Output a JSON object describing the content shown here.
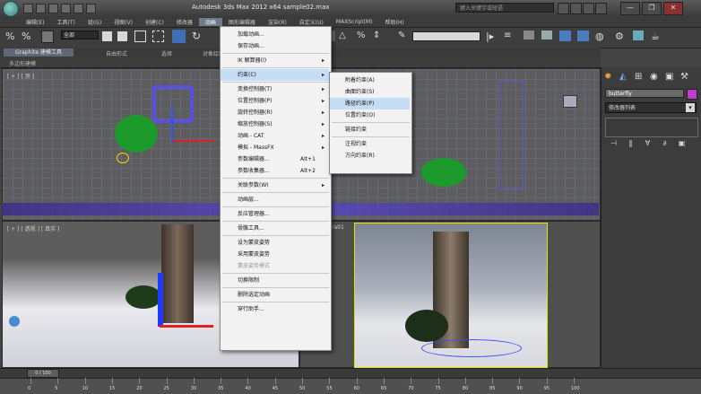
{
  "window": {
    "title": "Autodesk 3ds Max  2012 x64     sample02.max",
    "search_placeholder": "键入关键字或短语",
    "controls": [
      "—",
      "❐",
      "✕"
    ]
  },
  "menubar": {
    "items": [
      "编辑(E)",
      "工具(T)",
      "组(G)",
      "视图(V)",
      "创建(C)",
      "修改器",
      "动画",
      "图形编辑器",
      "渲染(R)",
      "自定义(U)",
      "MAXScript(M)",
      "帮助(H)"
    ]
  },
  "toolbar": {
    "selection_filter": "全部"
  },
  "ribbon": {
    "tabs": [
      "Graphite 建模工具",
      "自由形式",
      "选择",
      "对象绘制"
    ],
    "subbar_label": "多边形建模"
  },
  "viewports": {
    "top_left_label": "[ + ] [ 顶 ]",
    "bottom_left_label": "[ + ] [ 透视 ] [ 真实 ]",
    "bottom_right_label": "ra01"
  },
  "command_panel": {
    "object_name": "butterfly",
    "object_color": "#c03ccc",
    "modifier_list": "修改器列表",
    "stack_icons": [
      "⊣",
      "‖",
      "∀",
      "∂",
      "▣"
    ]
  },
  "timeline": {
    "frame": "0 / 100",
    "ticks": [
      "0",
      "5",
      "10",
      "15",
      "20",
      "25",
      "30",
      "35",
      "40",
      "45",
      "50",
      "55",
      "60",
      "65",
      "70",
      "75",
      "80",
      "85",
      "90",
      "95",
      "100"
    ]
  },
  "animation_menu": {
    "items": [
      {
        "label": "加载动画...",
        "shortcut": "",
        "submenu": false
      },
      {
        "label": "保存动画...",
        "shortcut": "",
        "submenu": false
      },
      {
        "sep": true
      },
      {
        "label": "IK 解算器(I)",
        "shortcut": "",
        "submenu": true
      },
      {
        "sep": true
      },
      {
        "label": "约束(C)",
        "shortcut": "",
        "submenu": true,
        "highlight": true
      },
      {
        "sep": true
      },
      {
        "label": "变换控制器(T)",
        "shortcut": "",
        "submenu": true
      },
      {
        "label": "位置控制器(P)",
        "shortcut": "",
        "submenu": true
      },
      {
        "label": "旋转控制器(R)",
        "shortcut": "",
        "submenu": true
      },
      {
        "label": "缩放控制器(S)",
        "shortcut": "",
        "submenu": true
      },
      {
        "label": "动画 - CAT",
        "shortcut": "",
        "submenu": true
      },
      {
        "label": "模拟 - MassFX",
        "shortcut": "",
        "submenu": true
      },
      {
        "label": "参数编辑器...",
        "shortcut": "Alt+1",
        "submenu": false
      },
      {
        "label": "参数收集器...",
        "shortcut": "Alt+2",
        "submenu": false
      },
      {
        "sep": true
      },
      {
        "label": "关联参数(W)",
        "shortcut": "",
        "submenu": true
      },
      {
        "sep": true
      },
      {
        "label": "动画层...",
        "shortcut": "",
        "submenu": false
      },
      {
        "sep": true
      },
      {
        "label": "反应管理器...",
        "shortcut": "",
        "submenu": false
      },
      {
        "sep": true
      },
      {
        "label": "骨骼工具...",
        "shortcut": "",
        "submenu": false
      },
      {
        "sep": true
      },
      {
        "label": "设为蒙皮姿势",
        "shortcut": "",
        "submenu": false
      },
      {
        "label": "采用蒙皮姿势",
        "shortcut": "",
        "submenu": false
      },
      {
        "label": "蒙皮姿势模式",
        "shortcut": "",
        "submenu": false,
        "disabled": true
      },
      {
        "sep": true
      },
      {
        "label": "切换限制",
        "shortcut": "",
        "submenu": false
      },
      {
        "sep": true
      },
      {
        "label": "删除选定动画",
        "shortcut": "",
        "submenu": false
      },
      {
        "sep": true
      },
      {
        "label": "穿行助手...",
        "shortcut": "",
        "submenu": false
      }
    ]
  },
  "constraints_submenu": {
    "items": [
      {
        "label": "附着约束(A)"
      },
      {
        "label": "曲面约束(S)"
      },
      {
        "label": "路径约束(P)",
        "highlight": true
      },
      {
        "label": "位置约束(O)"
      },
      {
        "sep": true
      },
      {
        "label": "链接约束"
      },
      {
        "sep": true
      },
      {
        "label": "注视约束"
      },
      {
        "label": "方向约束(R)"
      }
    ]
  }
}
